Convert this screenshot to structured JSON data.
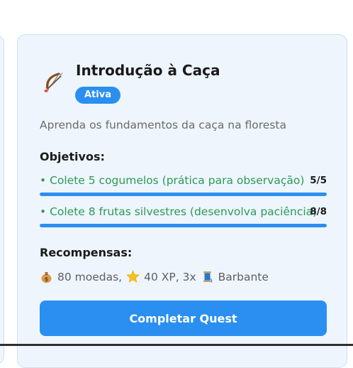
{
  "quest": {
    "icon": "bow-and-arrow-icon",
    "title": "Introdução à Caça",
    "status": "Ativa",
    "description": "Aprenda os fundamentos da caça na floresta",
    "objectives_heading": "Objetivos:",
    "objectives": [
      {
        "text": "• Colete 5 cogumelos (prática para observação)",
        "count": "5/5",
        "progress": 1.0
      },
      {
        "text": "• Colete 8 frutas silvestres (desenvolva paciência)",
        "count": "8/8",
        "progress": 1.0
      }
    ],
    "rewards_heading": "Recompensas:",
    "rewards": [
      {
        "icon": "money-bag-icon",
        "text": "80 moedas,"
      },
      {
        "icon": "star-icon",
        "text": "40 XP, 3x"
      },
      {
        "icon": "spool-of-thread-icon",
        "text": "Barbante"
      }
    ],
    "complete_button": "Completar Quest"
  },
  "colors": {
    "accent": "#2a8ff0",
    "objective_text": "#2b9a55",
    "card_background": "#eef5fd"
  }
}
